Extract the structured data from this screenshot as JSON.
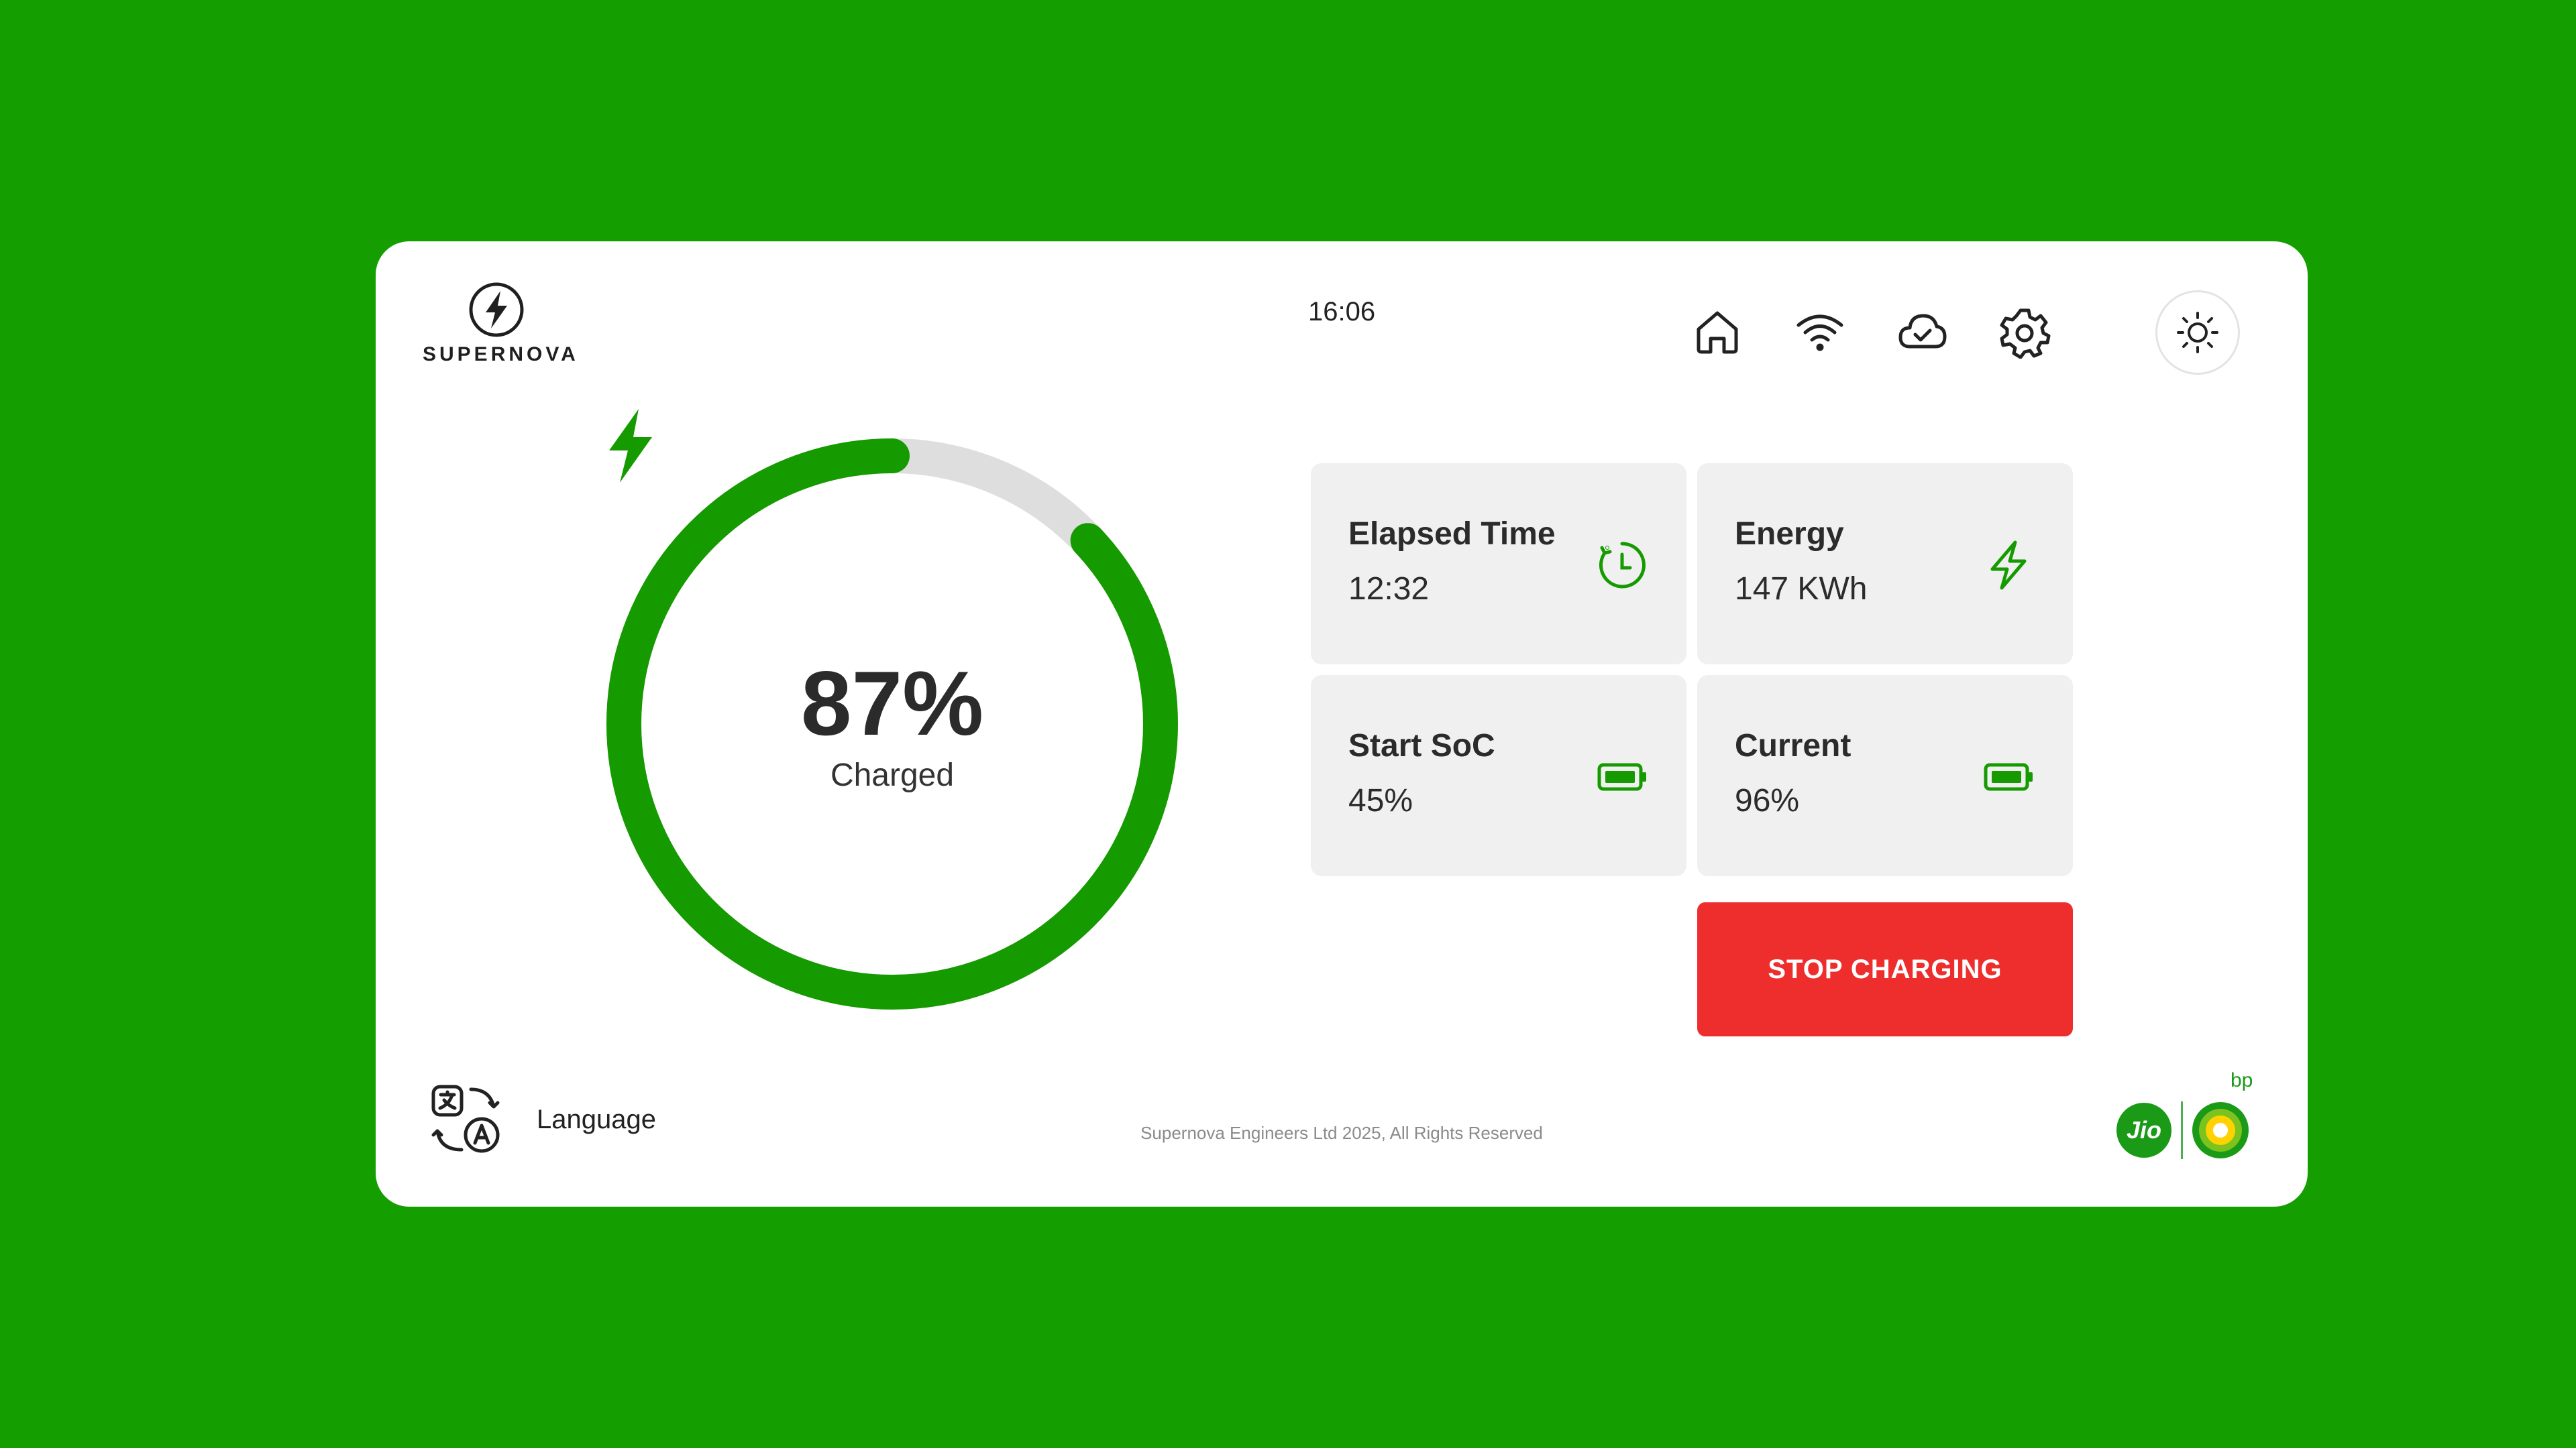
{
  "brand": {
    "name": "SUPERNOVA"
  },
  "header": {
    "time": "16:06",
    "nav_icons": [
      "home-icon",
      "wifi-icon",
      "cloud-check-icon",
      "gear-icon"
    ],
    "theme_icon": "sun-icon"
  },
  "gauge": {
    "percent": 87,
    "value_text": "87%",
    "label": "Charged",
    "icon": "lightning-bolt-icon"
  },
  "cards": {
    "elapsed_time": {
      "title": "Elapsed Time",
      "value": "12:32",
      "icon": "timer-icon"
    },
    "energy": {
      "title": "Energy",
      "value": "147 KWh",
      "icon": "lightning-bolt-icon"
    },
    "start_soc": {
      "title": "Start SoC",
      "value": "45%",
      "icon": "battery-icon"
    },
    "current": {
      "title": "Current",
      "value": "96%",
      "icon": "battery-icon"
    }
  },
  "actions": {
    "stop_label": "STOP CHARGING"
  },
  "footer": {
    "language_label": "Language",
    "copyright": "Supernova Engineers Ltd 2025, All Rights Reserved",
    "partner_jio": "Jio",
    "partner_bp": "bp"
  },
  "colors": {
    "background": "#149e00",
    "accent": "#159a00",
    "track": "#dedede",
    "stop": "#ee2d2d",
    "card": "#f0f0f0"
  }
}
